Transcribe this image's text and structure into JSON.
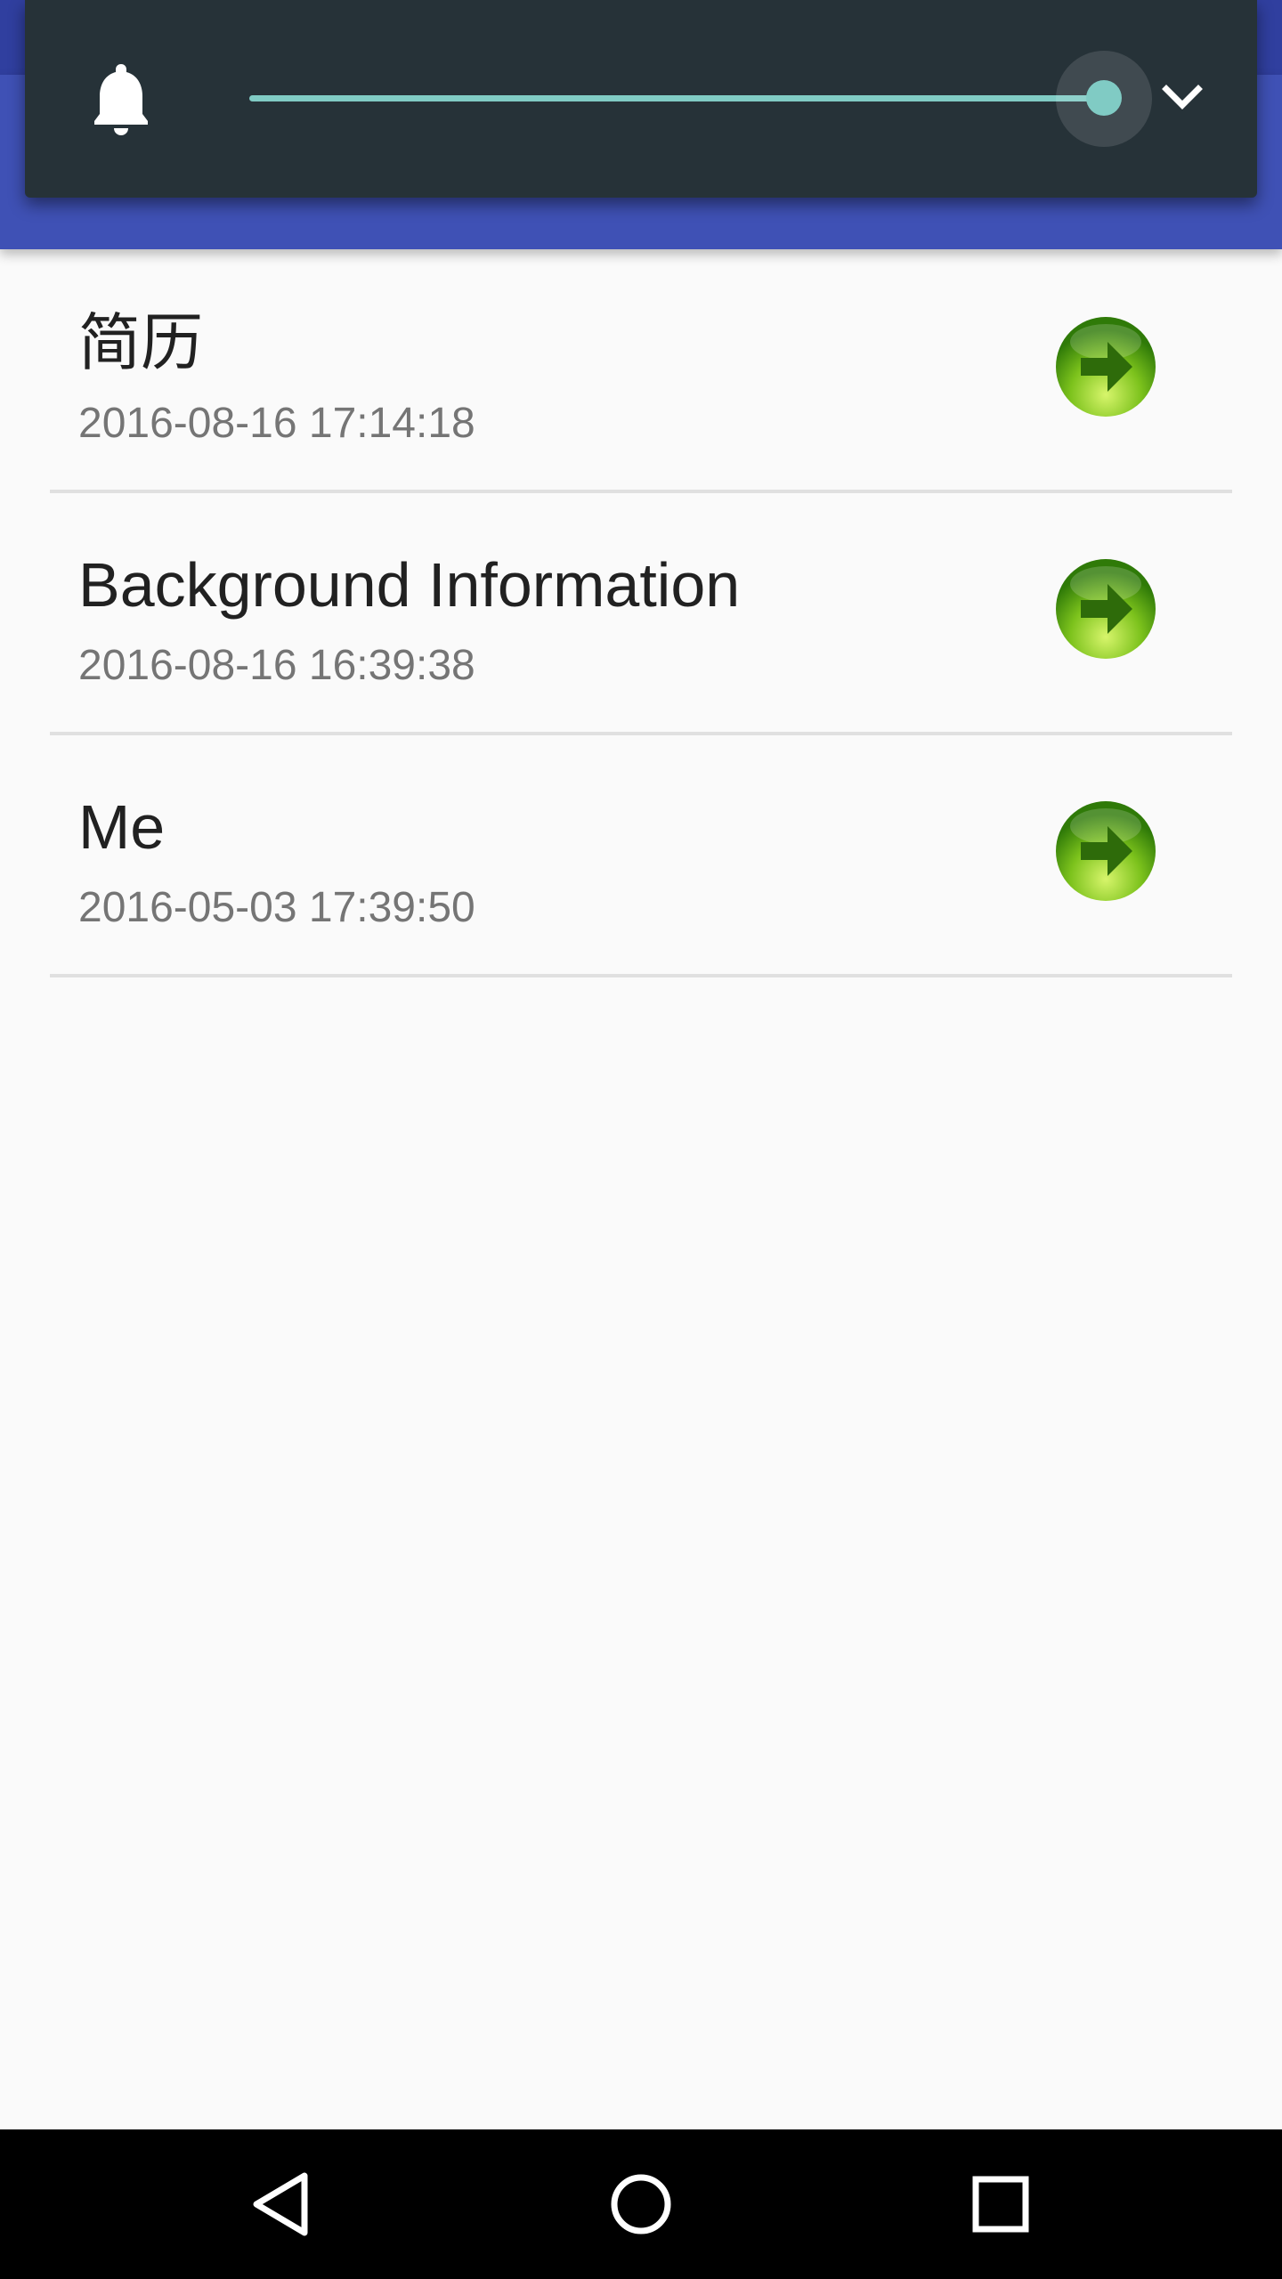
{
  "volume_panel": {
    "icon": "bell-icon",
    "level": 1.0,
    "accent_color": "#80cbc4",
    "expand_icon": "chevron-down-icon"
  },
  "list": {
    "items": [
      {
        "title": "简历",
        "date": "2016-08-16 17:14:18",
        "icon": "arrow-right-icon"
      },
      {
        "title": "Background Information",
        "date": "2016-08-16 16:39:38",
        "icon": "arrow-right-icon"
      },
      {
        "title": "Me",
        "date": "2016-05-03 17:39:50",
        "icon": "arrow-right-icon"
      }
    ]
  },
  "nav_bar": {
    "back_icon": "back-triangle-icon",
    "home_icon": "home-circle-icon",
    "recents_icon": "recents-square-icon"
  },
  "colors": {
    "app_bar": "#3f51b5",
    "status_bar": "#303f9f",
    "panel_bg": "#263238"
  }
}
